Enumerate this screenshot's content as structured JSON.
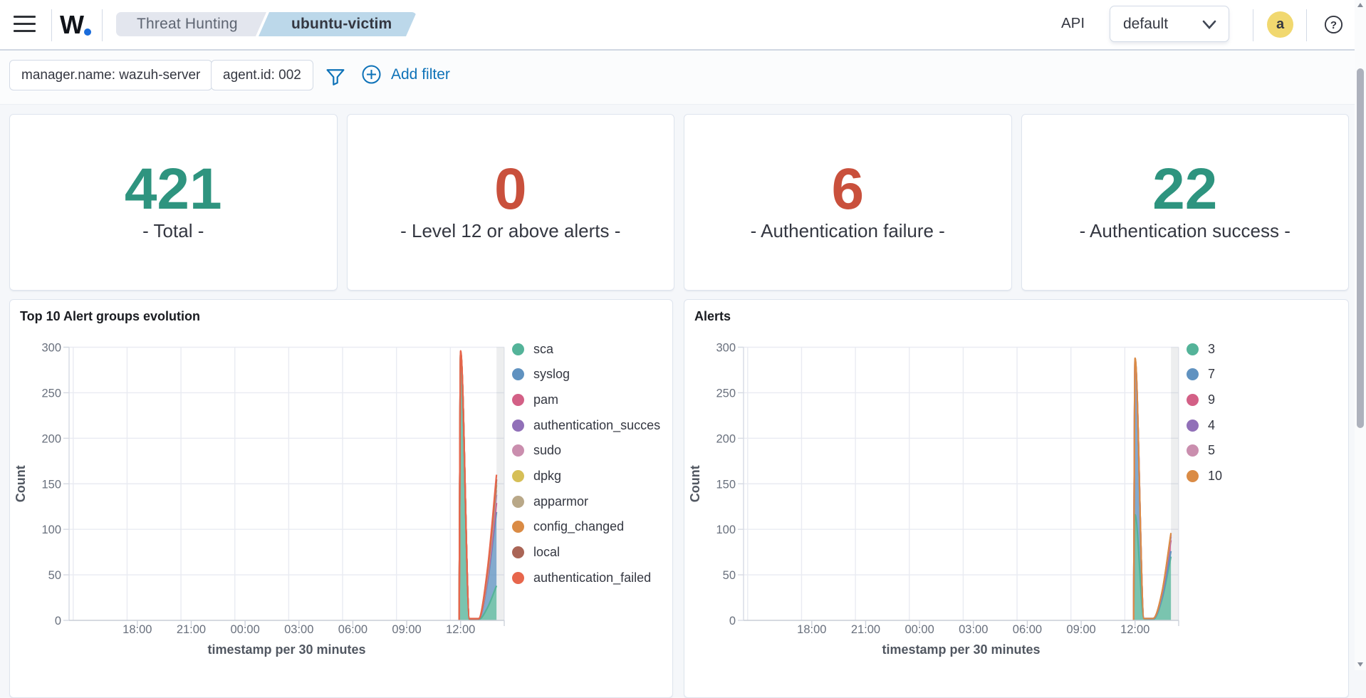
{
  "header": {
    "logo_text": "W",
    "logo_dot": ".",
    "breadcrumbs": [
      "Threat Hunting",
      "ubuntu-victim"
    ],
    "api_label": "API",
    "index_pattern": "default",
    "avatar_initial": "a",
    "icons": [
      "menu-icon",
      "chevron-down-icon",
      "help-icon"
    ]
  },
  "filters": {
    "pills": [
      "manager.name: wazuh-server",
      "agent.id: 002"
    ],
    "add_filter_label": "Add filter",
    "accent_color": "#0e72b8"
  },
  "stats": [
    {
      "value": "421",
      "label": "- Total -",
      "color": "#2e947f"
    },
    {
      "value": "0",
      "label": "- Level 12 or above alerts -",
      "color": "#c9503c"
    },
    {
      "value": "6",
      "label": "- Authentication failure -",
      "color": "#c9503c"
    },
    {
      "value": "22",
      "label": "- Authentication success -",
      "color": "#2e947f"
    }
  ],
  "chart_data": [
    {
      "type": "area",
      "stacked": true,
      "title": "Top 10 Alert groups evolution",
      "xlabel": "timestamp per 30 minutes",
      "ylabel": "Count",
      "ylim": [
        0,
        300
      ],
      "yticks": [
        0,
        50,
        100,
        150,
        200,
        250,
        300
      ],
      "xticklabels": [
        "18:00",
        "21:00",
        "00:00",
        "03:00",
        "06:00",
        "09:00",
        "12:00"
      ],
      "xtick_hours": [
        -6,
        -3,
        0,
        3,
        6,
        9,
        12
      ],
      "x_domain_hours": [
        -9.8,
        14.43
      ],
      "gridline_hours": [
        14.43,
        11.43,
        8.43,
        5.43,
        2.43,
        -0.57,
        -3.57,
        -6.57,
        -9.57
      ],
      "partial_bucket_hours": [
        14.0,
        14.43
      ],
      "legend_position": "right",
      "grid": true,
      "fill_opacity": 0.78,
      "x": [
        "11:55",
        "12:00",
        "12:30",
        "13:00",
        "13:30",
        "14:00"
      ],
      "x_hours": [
        11.92,
        12,
        12.5,
        13,
        13.5,
        14
      ],
      "series": [
        {
          "name": "sca",
          "color": "#54B399",
          "values": [
            0,
            289,
            1,
            1,
            14,
            38
          ]
        },
        {
          "name": "syslog",
          "color": "#6092C0",
          "values": [
            0,
            3,
            0.3,
            0.5,
            28,
            81
          ]
        },
        {
          "name": "pam",
          "color": "#D36086",
          "values": [
            0,
            1,
            0,
            0,
            3,
            10
          ]
        },
        {
          "name": "authentication_succes",
          "color": "#9170B8",
          "values": [
            0,
            1,
            0,
            0,
            3,
            9
          ]
        },
        {
          "name": "sudo",
          "color": "#CA8EAE",
          "values": [
            0,
            0,
            0,
            0,
            2,
            5
          ]
        },
        {
          "name": "dpkg",
          "color": "#D6BF57",
          "values": [
            0,
            0,
            0,
            0,
            2,
            5
          ]
        },
        {
          "name": "apparmor",
          "color": "#B9A888",
          "values": [
            0,
            0,
            0,
            0,
            0.5,
            1
          ]
        },
        {
          "name": "config_changed",
          "color": "#DA8B45",
          "values": [
            0,
            0,
            0,
            0,
            2,
            5
          ]
        },
        {
          "name": "local",
          "color": "#AA6556",
          "values": [
            0,
            0,
            0,
            0,
            0.5,
            1
          ]
        },
        {
          "name": "authentication_failed",
          "color": "#E7664C",
          "values": [
            0,
            2,
            0.7,
            0.5,
            2,
            5
          ]
        }
      ]
    },
    {
      "type": "area",
      "stacked": true,
      "title": "Alerts",
      "xlabel": "timestamp per 30 minutes",
      "ylabel": "Count",
      "ylim": [
        0,
        300
      ],
      "yticks": [
        0,
        50,
        100,
        150,
        200,
        250,
        300
      ],
      "xticklabels": [
        "18:00",
        "21:00",
        "00:00",
        "03:00",
        "06:00",
        "09:00",
        "12:00"
      ],
      "xtick_hours": [
        -6,
        -3,
        0,
        3,
        6,
        9,
        12
      ],
      "x_domain_hours": [
        -9.8,
        14.43
      ],
      "gridline_hours": [
        14.43,
        11.43,
        8.43,
        5.43,
        2.43,
        -0.57,
        -3.57,
        -6.57,
        -9.57
      ],
      "partial_bucket_hours": [
        14.0,
        14.43
      ],
      "legend_position": "right",
      "grid": true,
      "fill_opacity": 0.78,
      "x": [
        "11:55",
        "12:00",
        "12:30",
        "13:00",
        "13:30",
        "14:00"
      ],
      "x_hours": [
        11.92,
        12,
        12.5,
        13,
        13.5,
        14
      ],
      "series": [
        {
          "name": "3",
          "color": "#54B399",
          "values": [
            0,
            116,
            1.5,
            1,
            23,
            70
          ]
        },
        {
          "name": "7",
          "color": "#6092C0",
          "values": [
            0,
            167,
            0.5,
            0.5,
            2,
            6
          ]
        },
        {
          "name": "9",
          "color": "#D36086",
          "values": [
            0,
            3,
            0,
            0.5,
            4,
            12
          ]
        },
        {
          "name": "4",
          "color": "#9170B8",
          "values": [
            0,
            1,
            0,
            0,
            1,
            4
          ]
        },
        {
          "name": "5",
          "color": "#CA8EAE",
          "values": [
            0,
            0.5,
            0,
            0,
            0.5,
            2
          ]
        },
        {
          "name": "10",
          "color": "#DA8B45",
          "values": [
            0,
            0.5,
            0,
            0,
            0.5,
            2
          ]
        }
      ]
    }
  ],
  "scrollbar": {
    "thumb_top": 96,
    "thumb_height": 505
  }
}
